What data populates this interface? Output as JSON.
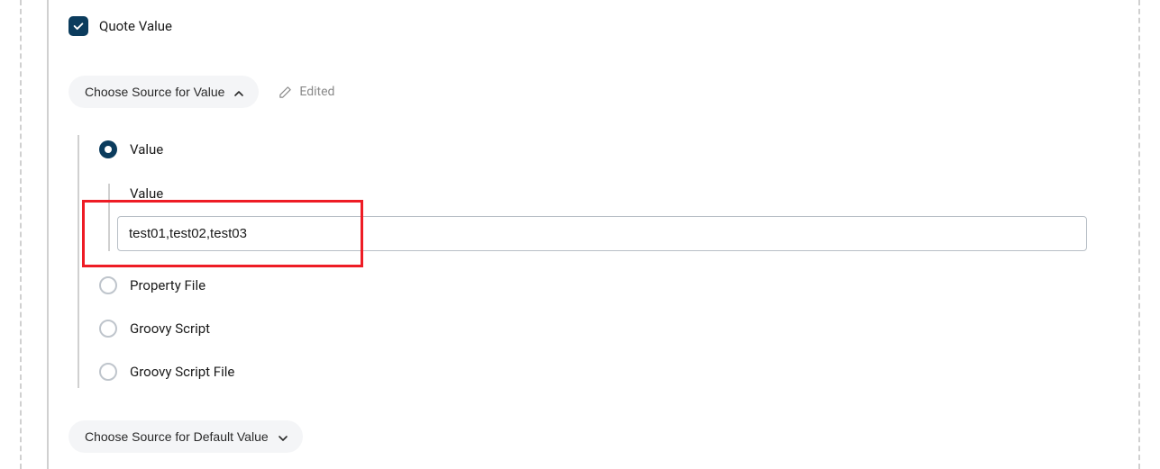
{
  "quoteValue": {
    "label": "Quote Value",
    "checked": true
  },
  "sourcePill": {
    "label": "Choose Source for Value",
    "expanded": true
  },
  "editedIndicator": {
    "label": "Edited"
  },
  "radioOptions": {
    "value": {
      "label": "Value",
      "selected": true
    },
    "propertyFile": {
      "label": "Property File",
      "selected": false
    },
    "groovyScript": {
      "label": "Groovy Script",
      "selected": false
    },
    "groovyScriptFile": {
      "label": "Groovy Script File",
      "selected": false
    }
  },
  "valueField": {
    "label": "Value",
    "value": "test01,test02,test03"
  },
  "defaultPill": {
    "label": "Choose Source for Default Value",
    "expanded": false
  }
}
